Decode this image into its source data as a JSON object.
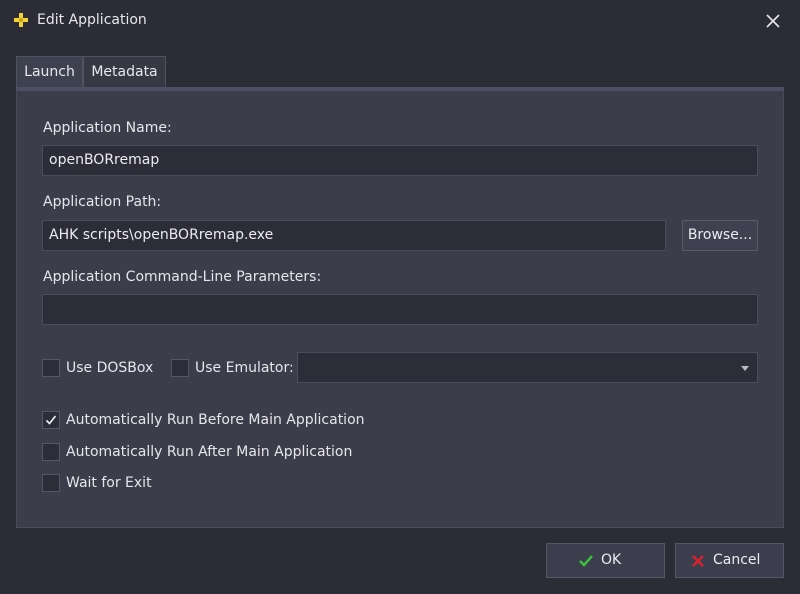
{
  "window": {
    "title": "Edit Application"
  },
  "tabs": [
    {
      "label": "Launch"
    },
    {
      "label": "Metadata"
    }
  ],
  "form": {
    "name_label": "Application Name:",
    "name_value": "openBORremap",
    "path_label": "Application Path:",
    "path_value": "AHK scripts\\openBORremap.exe",
    "browse_label": "Browse...",
    "params_label": "Application Command-Line Parameters:",
    "params_value": "",
    "use_dosbox_label": "Use DOSBox",
    "use_dosbox_checked": false,
    "use_emulator_label": "Use Emulator:",
    "use_emulator_checked": false,
    "emulator_selected": "",
    "run_before_label": "Automatically Run Before Main Application",
    "run_before_checked": true,
    "run_after_label": "Automatically Run After Main Application",
    "run_after_checked": false,
    "wait_exit_label": "Wait for Exit",
    "wait_exit_checked": false
  },
  "footer": {
    "ok_label": "OK",
    "cancel_label": "Cancel"
  },
  "colors": {
    "ok_check": "#3cc43c",
    "cancel_x": "#d8232a",
    "app_icon": "#f2d23a"
  },
  "icons": {
    "app": "app-icon",
    "close": "close-icon",
    "ok": "checkmark-icon",
    "cancel": "x-icon"
  }
}
